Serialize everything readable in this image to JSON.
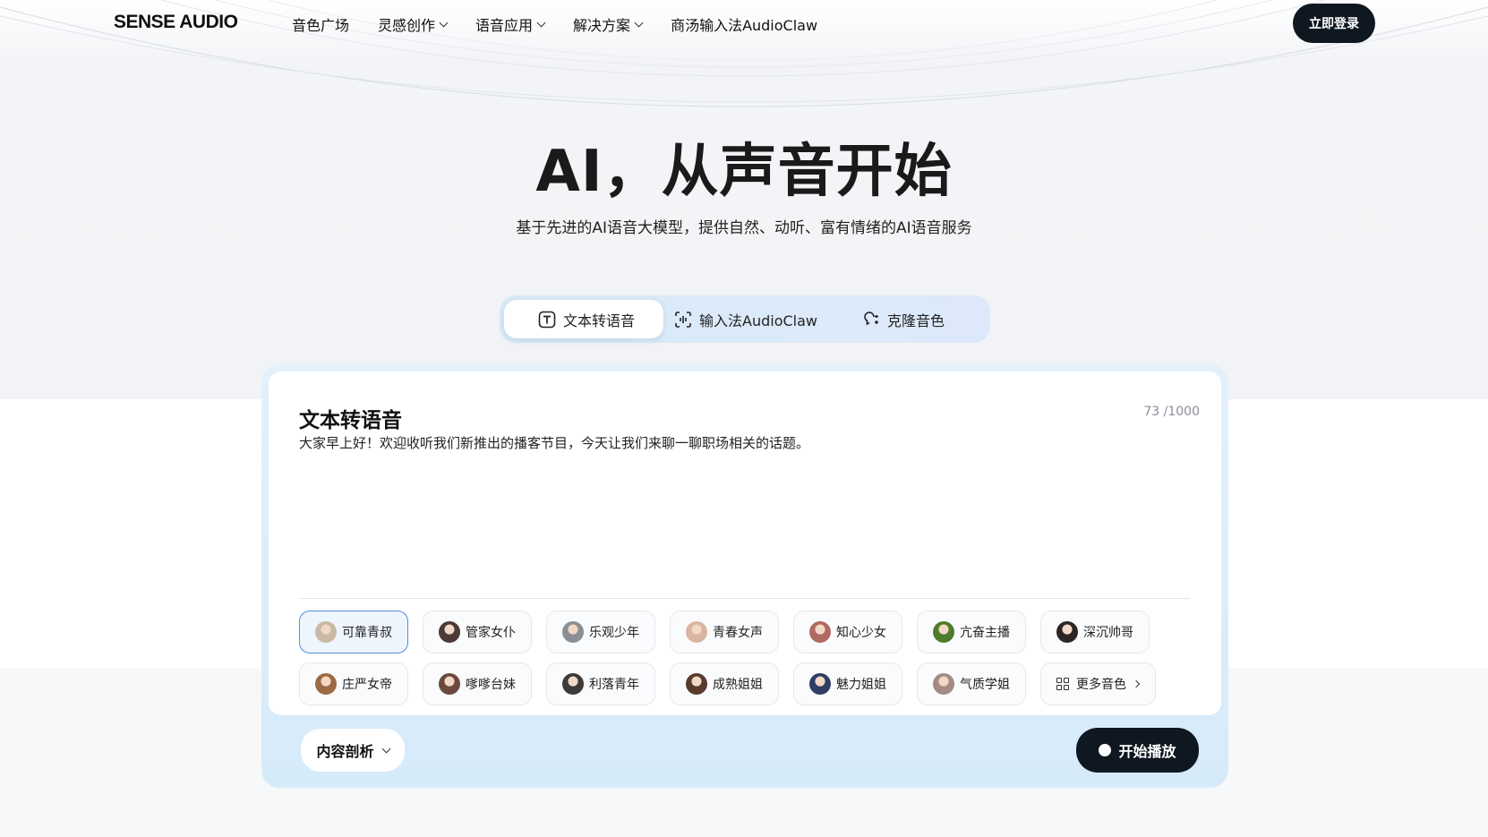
{
  "header": {
    "logo": "SENSE AUDIO",
    "nav": [
      {
        "label": "音色广场",
        "dropdown": false
      },
      {
        "label": "灵感创作",
        "dropdown": true
      },
      {
        "label": "语音应用",
        "dropdown": true
      },
      {
        "label": "解决方案",
        "dropdown": true
      },
      {
        "label": "商汤输入法AudioClaw",
        "dropdown": false
      }
    ],
    "login_label": "立即登录"
  },
  "hero": {
    "title": "AI，从声音开始",
    "subtitle": "基于先进的AI语音大模型，提供自然、动听、富有情绪的AI语音服务"
  },
  "tabs": [
    {
      "label": "文本转语音",
      "icon": "text-icon",
      "active": true
    },
    {
      "label": "输入法AudioClaw",
      "icon": "voice-scan-icon",
      "active": false
    },
    {
      "label": "克隆音色",
      "icon": "clone-voice-icon",
      "active": false
    }
  ],
  "editor": {
    "title": "文本转语音",
    "char_count": "73 /1000",
    "text": "大家早上好！欢迎收听我们新推出的播客节目，今天让我们来聊一聊职场相关的话题。"
  },
  "voices": [
    {
      "label": "可靠青叔",
      "selected": true,
      "avatar_color": "#c9b8a6"
    },
    {
      "label": "管家女仆",
      "selected": false,
      "avatar_color": "#4a3b36"
    },
    {
      "label": "乐观少年",
      "selected": false,
      "avatar_color": "#8a8f95"
    },
    {
      "label": "青春女声",
      "selected": false,
      "avatar_color": "#d9b5a1"
    },
    {
      "label": "知心少女",
      "selected": false,
      "avatar_color": "#b06a64"
    },
    {
      "label": "亢奋主播",
      "selected": false,
      "avatar_color": "#4f7b2e"
    },
    {
      "label": "深沉帅哥",
      "selected": false,
      "avatar_color": "#2b2623"
    },
    {
      "label": "庄严女帝",
      "selected": false,
      "avatar_color": "#9c6a44"
    },
    {
      "label": "嗲嗲台妹",
      "selected": false,
      "avatar_color": "#6b4a3d"
    },
    {
      "label": "利落青年",
      "selected": false,
      "avatar_color": "#3d3a38"
    },
    {
      "label": "成熟姐姐",
      "selected": false,
      "avatar_color": "#5a3a2e"
    },
    {
      "label": "魅力姐姐",
      "selected": false,
      "avatar_color": "#2f3f63"
    },
    {
      "label": "气质学姐",
      "selected": false,
      "avatar_color": "#a58a86"
    }
  ],
  "more_voices_label": "更多音色",
  "actions": {
    "analyze_label": "内容剖析",
    "play_label": "开始播放"
  }
}
